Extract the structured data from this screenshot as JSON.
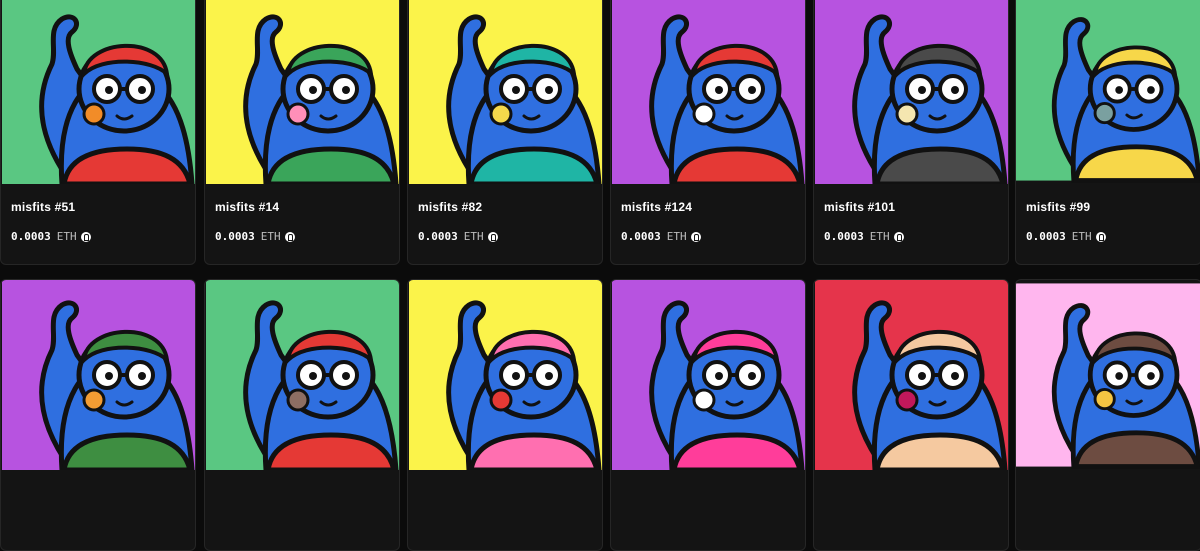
{
  "cards": [
    {
      "name": "misfits #51",
      "price": "0.0003",
      "currency": "ETH",
      "chain_icon": "base-chain-icon",
      "bg": "#5ac782",
      "accent": "#e53935",
      "accessory": "#f28c28"
    },
    {
      "name": "misfits #14",
      "price": "0.0003",
      "currency": "ETH",
      "chain_icon": "base-chain-icon",
      "bg": "#fbf34a",
      "accent": "#3aa55a",
      "accessory": "#ff8fb8"
    },
    {
      "name": "misfits #82",
      "price": "0.0003",
      "currency": "ETH",
      "chain_icon": "base-chain-icon",
      "bg": "#fbf34a",
      "accent": "#1fb5a5",
      "accessory": "#f5d84b"
    },
    {
      "name": "misfits #124",
      "price": "0.0003",
      "currency": "ETH",
      "chain_icon": "base-chain-icon",
      "bg": "#b753e0",
      "accent": "#e53935",
      "accessory": "#ffffff"
    },
    {
      "name": "misfits #101",
      "price": "0.0003",
      "currency": "ETH",
      "chain_icon": "base-chain-icon",
      "bg": "#b753e0",
      "accent": "#4a4a4a",
      "accessory": "#f5e6b0"
    },
    {
      "name": "misfits #99",
      "price": "0.0003",
      "currency": "ETH",
      "chain_icon": "base-chain-icon",
      "bg": "#5ac782",
      "accent": "#f7d749",
      "accessory": "#7aa0a0"
    },
    {
      "bg": "#b753e0",
      "accent": "#3e8e41",
      "accessory": "#f39c33"
    },
    {
      "bg": "#5ac782",
      "accent": "#e53935",
      "accessory": "#8d6e63"
    },
    {
      "bg": "#fbf34a",
      "accent": "#ff6fb0",
      "accessory": "#e53935"
    },
    {
      "bg": "#b753e0",
      "accent": "#ff3d9a",
      "accessory": "#ffffff"
    },
    {
      "bg": "#e5344b",
      "accent": "#f5c9a0",
      "accessory": "#c2185b"
    },
    {
      "bg": "#ffb6ee",
      "accent": "#6d4c41",
      "accessory": "#f5c542"
    }
  ]
}
